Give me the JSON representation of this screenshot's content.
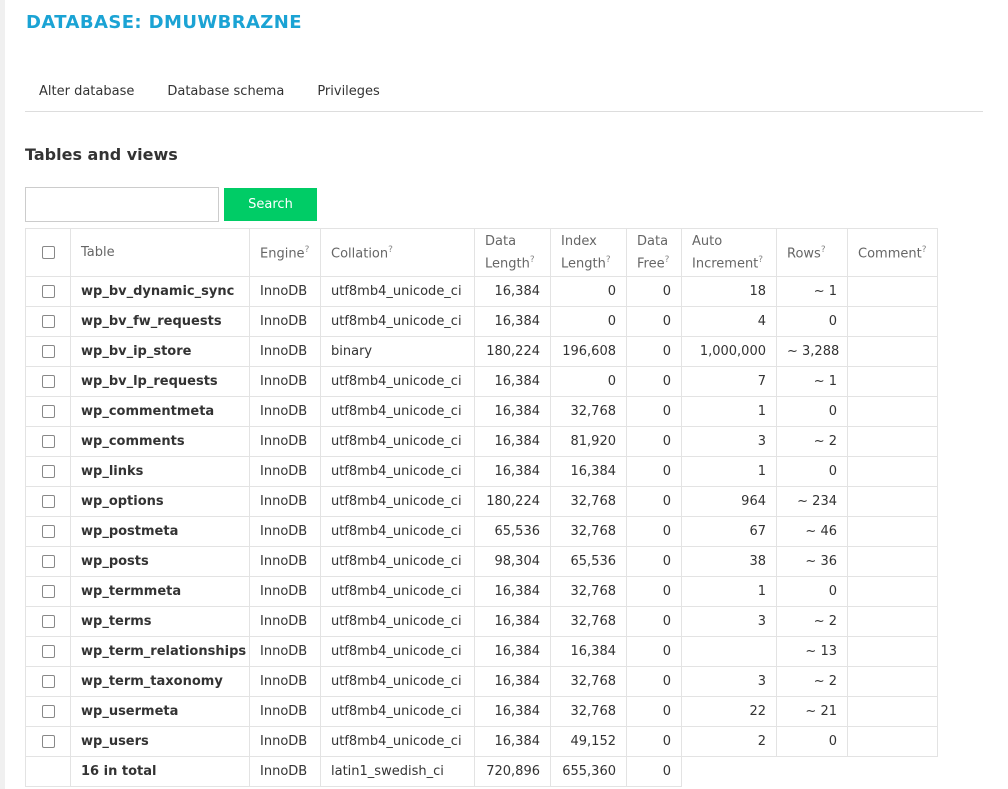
{
  "page": {
    "title": "DATABASE: DMUWBRAZNE",
    "tabs": [
      "Alter database",
      "Database schema",
      "Privileges"
    ],
    "section_title": "Tables and views",
    "search": {
      "value": "",
      "placeholder": "",
      "button_label": "Search"
    }
  },
  "table": {
    "headers": {
      "table": "Table",
      "engine": "Engine",
      "collation": "Collation",
      "data_length_1": "Data",
      "data_length_2": "Length",
      "index_length_1": "Index",
      "index_length_2": "Length",
      "data_free_1": "Data",
      "data_free_2": "Free",
      "auto_increment_1": "Auto",
      "auto_increment_2": "Increment",
      "rows": "Rows",
      "comment": "Comment",
      "help_mark": "?"
    },
    "rows": [
      {
        "name": "wp_bv_dynamic_sync",
        "engine": "InnoDB",
        "collation": "utf8mb4_unicode_ci",
        "data_length": "16,384",
        "index_length": "0",
        "data_free": "0",
        "auto_increment": "18",
        "rows": "~ 1",
        "comment": ""
      },
      {
        "name": "wp_bv_fw_requests",
        "engine": "InnoDB",
        "collation": "utf8mb4_unicode_ci",
        "data_length": "16,384",
        "index_length": "0",
        "data_free": "0",
        "auto_increment": "4",
        "rows": "0",
        "comment": ""
      },
      {
        "name": "wp_bv_ip_store",
        "engine": "InnoDB",
        "collation": "binary",
        "data_length": "180,224",
        "index_length": "196,608",
        "data_free": "0",
        "auto_increment": "1,000,000",
        "rows": "~ 3,288",
        "comment": ""
      },
      {
        "name": "wp_bv_lp_requests",
        "engine": "InnoDB",
        "collation": "utf8mb4_unicode_ci",
        "data_length": "16,384",
        "index_length": "0",
        "data_free": "0",
        "auto_increment": "7",
        "rows": "~ 1",
        "comment": ""
      },
      {
        "name": "wp_commentmeta",
        "engine": "InnoDB",
        "collation": "utf8mb4_unicode_ci",
        "data_length": "16,384",
        "index_length": "32,768",
        "data_free": "0",
        "auto_increment": "1",
        "rows": "0",
        "comment": ""
      },
      {
        "name": "wp_comments",
        "engine": "InnoDB",
        "collation": "utf8mb4_unicode_ci",
        "data_length": "16,384",
        "index_length": "81,920",
        "data_free": "0",
        "auto_increment": "3",
        "rows": "~ 2",
        "comment": ""
      },
      {
        "name": "wp_links",
        "engine": "InnoDB",
        "collation": "utf8mb4_unicode_ci",
        "data_length": "16,384",
        "index_length": "16,384",
        "data_free": "0",
        "auto_increment": "1",
        "rows": "0",
        "comment": ""
      },
      {
        "name": "wp_options",
        "engine": "InnoDB",
        "collation": "utf8mb4_unicode_ci",
        "data_length": "180,224",
        "index_length": "32,768",
        "data_free": "0",
        "auto_increment": "964",
        "rows": "~ 234",
        "comment": ""
      },
      {
        "name": "wp_postmeta",
        "engine": "InnoDB",
        "collation": "utf8mb4_unicode_ci",
        "data_length": "65,536",
        "index_length": "32,768",
        "data_free": "0",
        "auto_increment": "67",
        "rows": "~ 46",
        "comment": ""
      },
      {
        "name": "wp_posts",
        "engine": "InnoDB",
        "collation": "utf8mb4_unicode_ci",
        "data_length": "98,304",
        "index_length": "65,536",
        "data_free": "0",
        "auto_increment": "38",
        "rows": "~ 36",
        "comment": ""
      },
      {
        "name": "wp_termmeta",
        "engine": "InnoDB",
        "collation": "utf8mb4_unicode_ci",
        "data_length": "16,384",
        "index_length": "32,768",
        "data_free": "0",
        "auto_increment": "1",
        "rows": "0",
        "comment": ""
      },
      {
        "name": "wp_terms",
        "engine": "InnoDB",
        "collation": "utf8mb4_unicode_ci",
        "data_length": "16,384",
        "index_length": "32,768",
        "data_free": "0",
        "auto_increment": "3",
        "rows": "~ 2",
        "comment": ""
      },
      {
        "name": "wp_term_relationships",
        "engine": "InnoDB",
        "collation": "utf8mb4_unicode_ci",
        "data_length": "16,384",
        "index_length": "16,384",
        "data_free": "0",
        "auto_increment": "",
        "rows": "~ 13",
        "comment": ""
      },
      {
        "name": "wp_term_taxonomy",
        "engine": "InnoDB",
        "collation": "utf8mb4_unicode_ci",
        "data_length": "16,384",
        "index_length": "32,768",
        "data_free": "0",
        "auto_increment": "3",
        "rows": "~ 2",
        "comment": ""
      },
      {
        "name": "wp_usermeta",
        "engine": "InnoDB",
        "collation": "utf8mb4_unicode_ci",
        "data_length": "16,384",
        "index_length": "32,768",
        "data_free": "0",
        "auto_increment": "22",
        "rows": "~ 21",
        "comment": ""
      },
      {
        "name": "wp_users",
        "engine": "InnoDB",
        "collation": "utf8mb4_unicode_ci",
        "data_length": "16,384",
        "index_length": "49,152",
        "data_free": "0",
        "auto_increment": "2",
        "rows": "0",
        "comment": ""
      }
    ],
    "total": {
      "name": "16 in total",
      "engine": "InnoDB",
      "collation": "latin1_swedish_ci",
      "data_length": "720,896",
      "index_length": "655,360",
      "data_free": "0"
    }
  },
  "colors": {
    "title": "#1ba3d4",
    "search_button": "#00cc66",
    "border": "#e3e3e3"
  },
  "icons": {
    "checkbox": "checkbox-icon"
  }
}
